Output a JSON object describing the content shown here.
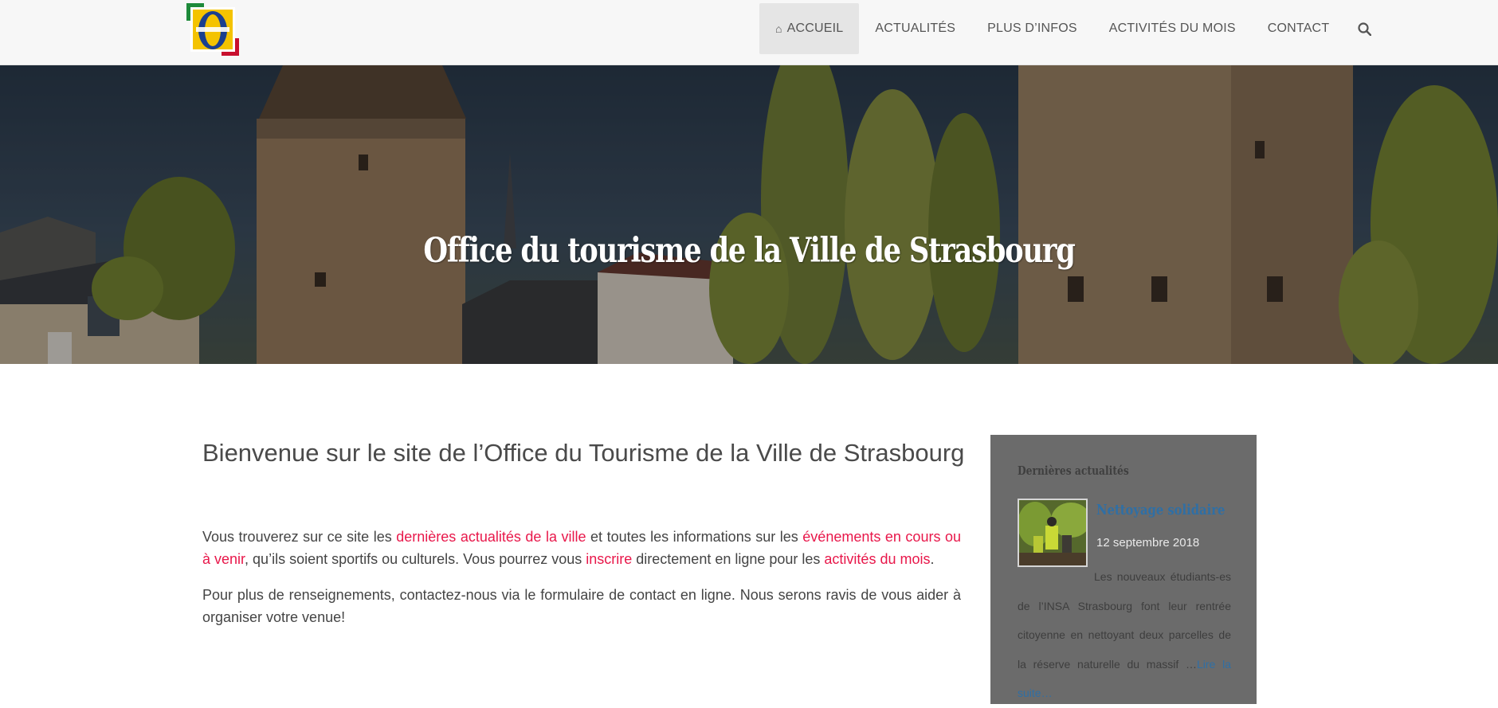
{
  "nav": {
    "items": [
      {
        "label": "Accueil",
        "active": true
      },
      {
        "label": "Actualités",
        "active": false
      },
      {
        "label": "Plus d’infos",
        "active": false
      },
      {
        "label": "Activités du mois",
        "active": false
      },
      {
        "label": "Contact",
        "active": false
      }
    ],
    "home_icon": "⌂",
    "search_icon": "search-icon"
  },
  "hero": {
    "title": "Office du tourisme de la Ville de Strasbourg"
  },
  "main": {
    "title": "Bienvenue sur le site de l’Office du Tourisme de la Ville de Strasbourg",
    "p1": {
      "t1": "Vous trouverez sur ce site les ",
      "l1": "dernières actualités de la ville",
      "t2": " et toutes les informations sur les ",
      "l2": "événements en cours ou à venir",
      "t3": ", qu’ils soient sportifs ou culturels. Vous pourrez vous ",
      "l3": "inscrire",
      "t4": " directement en ligne pour les ",
      "l4": "activités du mois",
      "t5": "."
    },
    "p2": "Pour plus de renseignements, contactez-nous via le formulaire de contact en ligne. Nous serons ravis de vous aider à organiser votre venue!"
  },
  "sidebar": {
    "title": "Dernières actualités",
    "post": {
      "title": "Nettoyage solidaire",
      "date": "12 septembre 2018",
      "excerpt": "Les nouveaux étudiants-es de l’INSA Strasbourg font leur rentrée citoyenne en nettoyant deux parcelles de la réserve naturelle du massif …",
      "read_more": "Lire la suite…"
    }
  },
  "colors": {
    "link": "#e8174a",
    "accent_blue": "#2f6fa5",
    "sidebar_bg": "#6b6b6b",
    "nav_bg": "#f7f7f7"
  }
}
